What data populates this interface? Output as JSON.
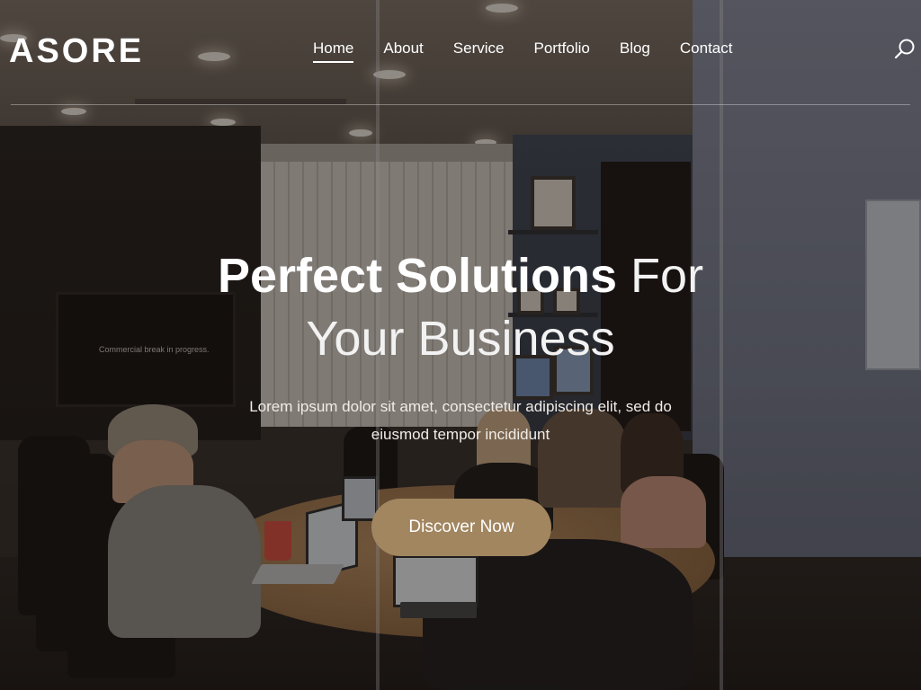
{
  "brand": {
    "logo": "ASORE"
  },
  "nav": {
    "items": [
      {
        "label": "Home",
        "active": true
      },
      {
        "label": "About",
        "active": false
      },
      {
        "label": "Service",
        "active": false
      },
      {
        "label": "Portfolio",
        "active": false
      },
      {
        "label": "Blog",
        "active": false
      },
      {
        "label": "Contact",
        "active": false
      }
    ],
    "search_icon": "search-icon"
  },
  "hero": {
    "headline_bold": "Perfect Solutions",
    "headline_light_1": "For",
    "headline_light_2": "Your Business",
    "subtitle_line_1": "Lorem ipsum dolor sit amet, consectetur adipiscing elit, sed do",
    "subtitle_line_2": "eiusmod tempor incididunt",
    "cta_label": "Discover Now",
    "background_tv_text": "Commercial break in progress."
  },
  "colors": {
    "accent": "#a28660",
    "text": "#ffffff"
  }
}
